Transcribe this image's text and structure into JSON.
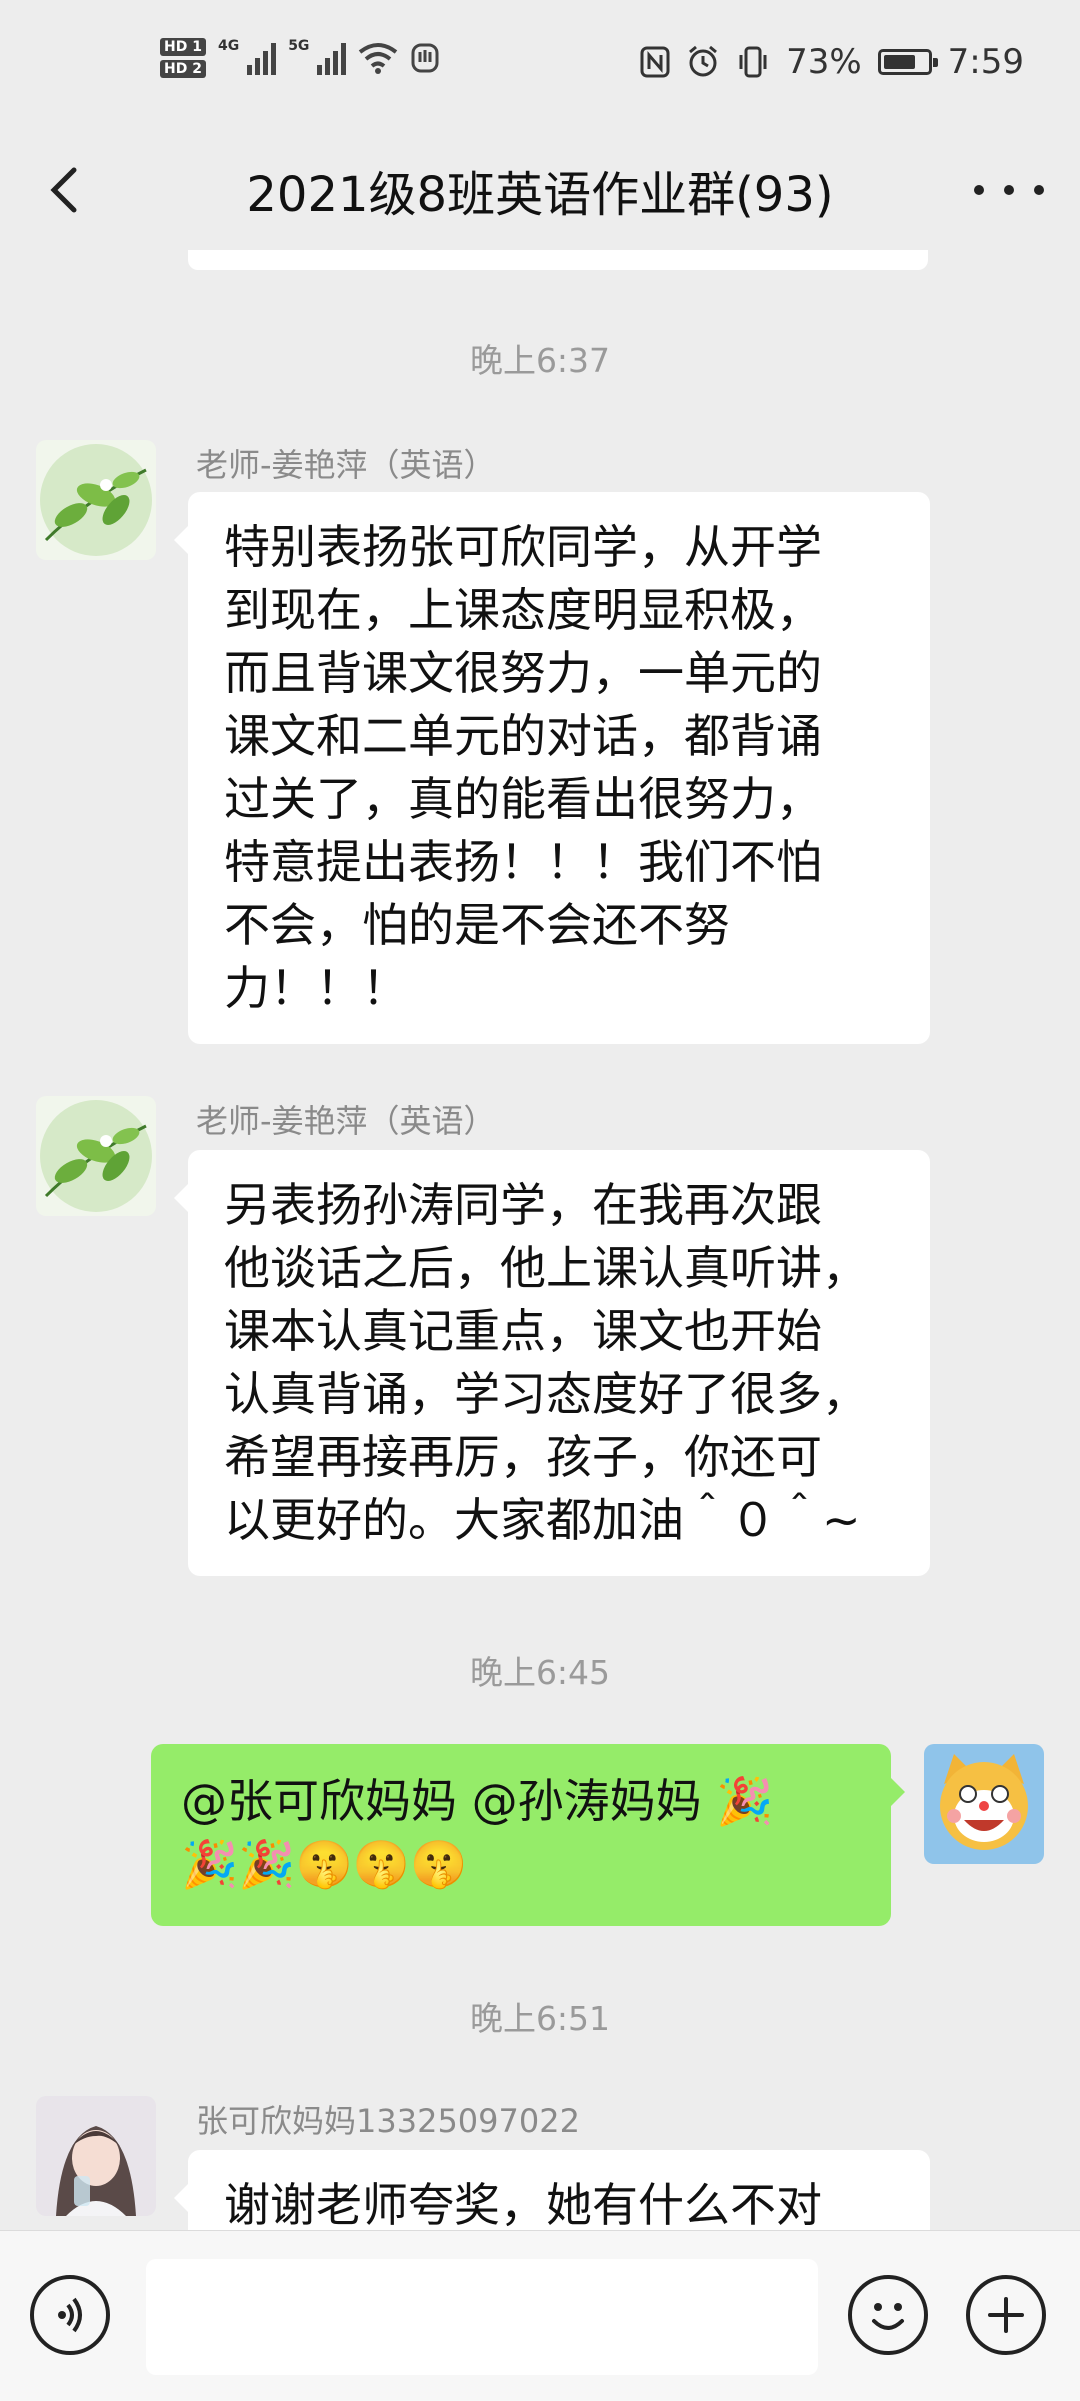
{
  "status_bar": {
    "hd1": "HD 1",
    "hd2": "HD 2",
    "net1": "4G",
    "net2": "5G",
    "battery_percent": "73%",
    "battery_level": 0.73,
    "time": "7:59"
  },
  "nav": {
    "title": "2021级8班英语作业群(93)"
  },
  "timestamps": [
    "晚上6:37",
    "晚上6:45",
    "晚上6:51"
  ],
  "messages": [
    {
      "sender": "老师-姜艳萍（英语）",
      "lines": [
        "特别表扬张可欣同学，从开学",
        "到现在，上课态度明显积极，",
        "而且背课文很努力，一单元的",
        "课文和二单元的对话，都背诵",
        "过关了，真的能看出很努力，",
        "特意提出表扬！！！我们不怕",
        "不会，怕的是不会还不努",
        "力！！！"
      ]
    },
    {
      "sender": "老师-姜艳萍（英语）",
      "lines": [
        "另表扬孙涛同学，在我再次跟",
        "他谈话之后，他上课认真听讲，",
        "课本认真记重点，课文也开始",
        "认真背诵，学习态度好了很多，",
        "希望再接再厉，孩子，你还可",
        "以更好的。大家都加油＾０＾~"
      ]
    },
    {
      "sender": "",
      "lines": [
        "@张可欣妈妈 @孙涛妈妈 🎉",
        "🎉🎉🤫🤫🤫"
      ]
    },
    {
      "sender": "张可欣妈妈13325097022",
      "lines": [
        "谢谢老师夸奖，她有什么不对"
      ]
    }
  ],
  "colors": {
    "background": "#ededed",
    "self_bubble": "#95ec69",
    "other_bubble": "#ffffff"
  },
  "icons": {
    "back": "chevron-left-icon",
    "more": "more-icon",
    "voice": "voice-icon",
    "emoji": "emoji-icon",
    "add": "plus-icon"
  }
}
